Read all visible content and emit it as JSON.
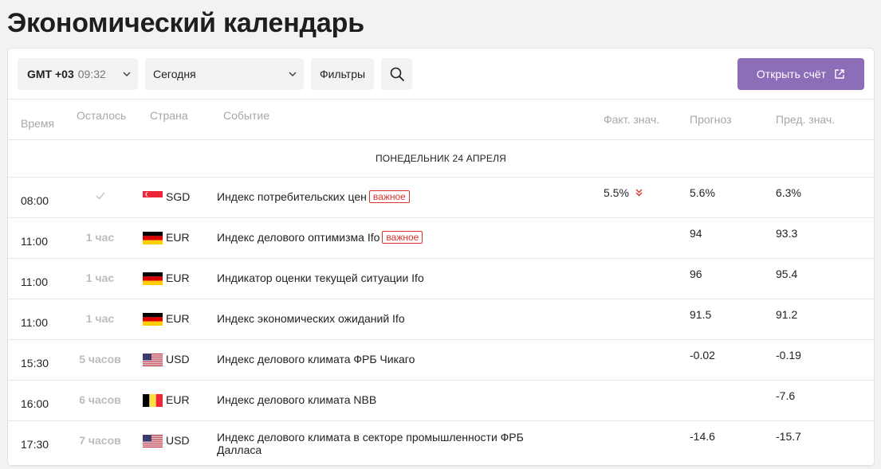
{
  "page": {
    "title": "Экономический календарь"
  },
  "toolbar": {
    "tz_label": "GMT +03",
    "tz_time": "09:32",
    "day_selected": "Сегодня",
    "filters_label": "Фильтры",
    "open_account_label": "Открыть счёт"
  },
  "columns": {
    "time": "Время",
    "left": "Осталось",
    "country": "Страна",
    "event": "Событие",
    "actual": "Факт. знач.",
    "forecast": "Прогноз",
    "previous": "Пред. знач."
  },
  "day_header": "ПОНЕДЕЛЬНИК 24 АПРЕЛЯ",
  "events": [
    {
      "time": "08:00",
      "left": "",
      "done": true,
      "flag": "sg",
      "currency": "SGD",
      "name": "Индекс потребительских цен",
      "badge": "важное",
      "actual": "5.5%",
      "trend": "down",
      "forecast": "5.6%",
      "previous": "6.3%"
    },
    {
      "time": "11:00",
      "left": "1 час",
      "flag": "de",
      "currency": "EUR",
      "name": "Индекс делового оптимизма Ifo",
      "badge": "важное",
      "actual": "",
      "forecast": "94",
      "previous": "93.3"
    },
    {
      "time": "11:00",
      "left": "1 час",
      "flag": "de",
      "currency": "EUR",
      "name": "Индикатор оценки текущей ситуации Ifo",
      "badge": "",
      "actual": "",
      "forecast": "96",
      "previous": "95.4"
    },
    {
      "time": "11:00",
      "left": "1 час",
      "flag": "de",
      "currency": "EUR",
      "name": "Индекс экономических ожиданий Ifo",
      "badge": "",
      "actual": "",
      "forecast": "91.5",
      "previous": "91.2"
    },
    {
      "time": "15:30",
      "left": "5 часов",
      "flag": "us",
      "currency": "USD",
      "name": "Индекс делового климата ФРБ Чикаго",
      "badge": "",
      "actual": "",
      "forecast": "-0.02",
      "previous": "-0.19"
    },
    {
      "time": "16:00",
      "left": "6 часов",
      "flag": "be",
      "currency": "EUR",
      "name": "Индекс делового климата NBB",
      "badge": "",
      "actual": "",
      "forecast": "",
      "previous": "-7.6"
    },
    {
      "time": "17:30",
      "left": "7 часов",
      "flag": "us",
      "currency": "USD",
      "name": "Индекс делового климата в секторе промышленности ФРБ Далласа",
      "badge": "",
      "actual": "",
      "forecast": "-14.6",
      "previous": "-15.7"
    }
  ],
  "colors": {
    "accent": "#8c6db8",
    "badge": "#d9342b",
    "trend_down": "#d9342b"
  },
  "icons": {
    "tz_dropdown": "chevron-down-icon",
    "day_dropdown": "chevron-down-icon",
    "search": "search-icon",
    "external": "external-link-icon",
    "done": "check-icon",
    "trend": "double-chevron-down-icon"
  }
}
